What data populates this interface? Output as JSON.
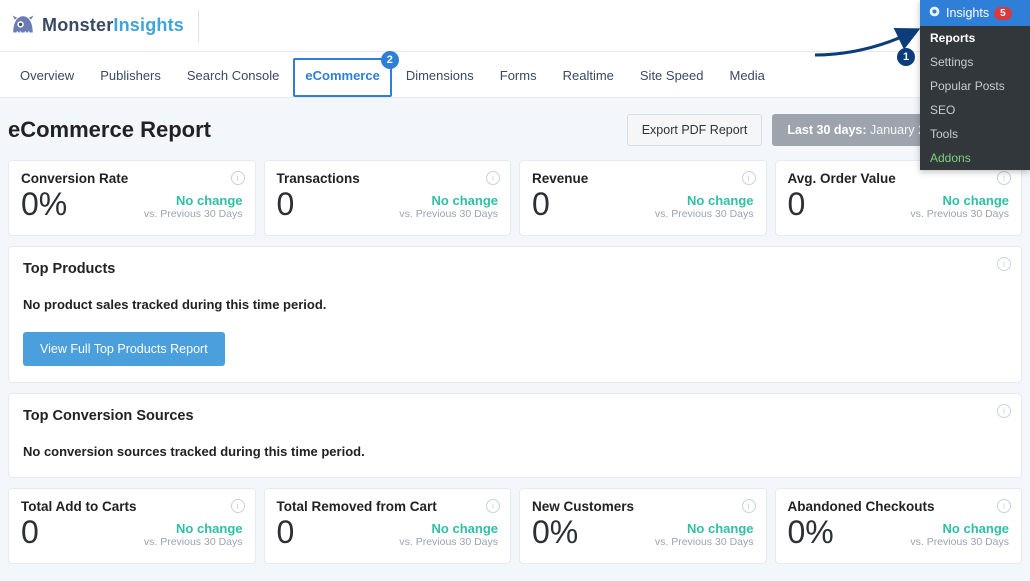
{
  "logo": {
    "part1": "Monster",
    "part2": "Insights"
  },
  "nav": {
    "items": [
      "Overview",
      "Publishers",
      "Search Console",
      "eCommerce",
      "Dimensions",
      "Forms",
      "Realtime",
      "Site Speed",
      "Media"
    ],
    "active_index": 3,
    "badge": "2"
  },
  "page": {
    "title": "eCommerce Report",
    "export_label": "Export PDF Report",
    "range_prefix": "Last 30 days:",
    "range_value": "January 25 - February"
  },
  "compare_text": "vs. Previous 30 Days",
  "stats_row1": [
    {
      "title": "Conversion Rate",
      "value": "0%",
      "change": "No change"
    },
    {
      "title": "Transactions",
      "value": "0",
      "change": "No change"
    },
    {
      "title": "Revenue",
      "value": "0",
      "change": "No change"
    },
    {
      "title": "Avg. Order Value",
      "value": "0",
      "change": "No change"
    }
  ],
  "panel_products": {
    "title": "Top Products",
    "empty_text": "No product sales tracked during this time period.",
    "button": "View Full Top Products Report"
  },
  "panel_sources": {
    "title": "Top Conversion Sources",
    "empty_text": "No conversion sources tracked during this time period."
  },
  "stats_row2": [
    {
      "title": "Total Add to Carts",
      "value": "0",
      "change": "No change"
    },
    {
      "title": "Total Removed from Cart",
      "value": "0",
      "change": "No change"
    },
    {
      "title": "New Customers",
      "value": "0%",
      "change": "No change"
    },
    {
      "title": "Abandoned Checkouts",
      "value": "0%",
      "change": "No change"
    }
  ],
  "admin": {
    "header": "Insights",
    "badge": "5",
    "items": [
      "Reports",
      "Settings",
      "Popular Posts",
      "SEO",
      "Tools",
      "Addons"
    ]
  },
  "annotation": {
    "one": "1"
  }
}
